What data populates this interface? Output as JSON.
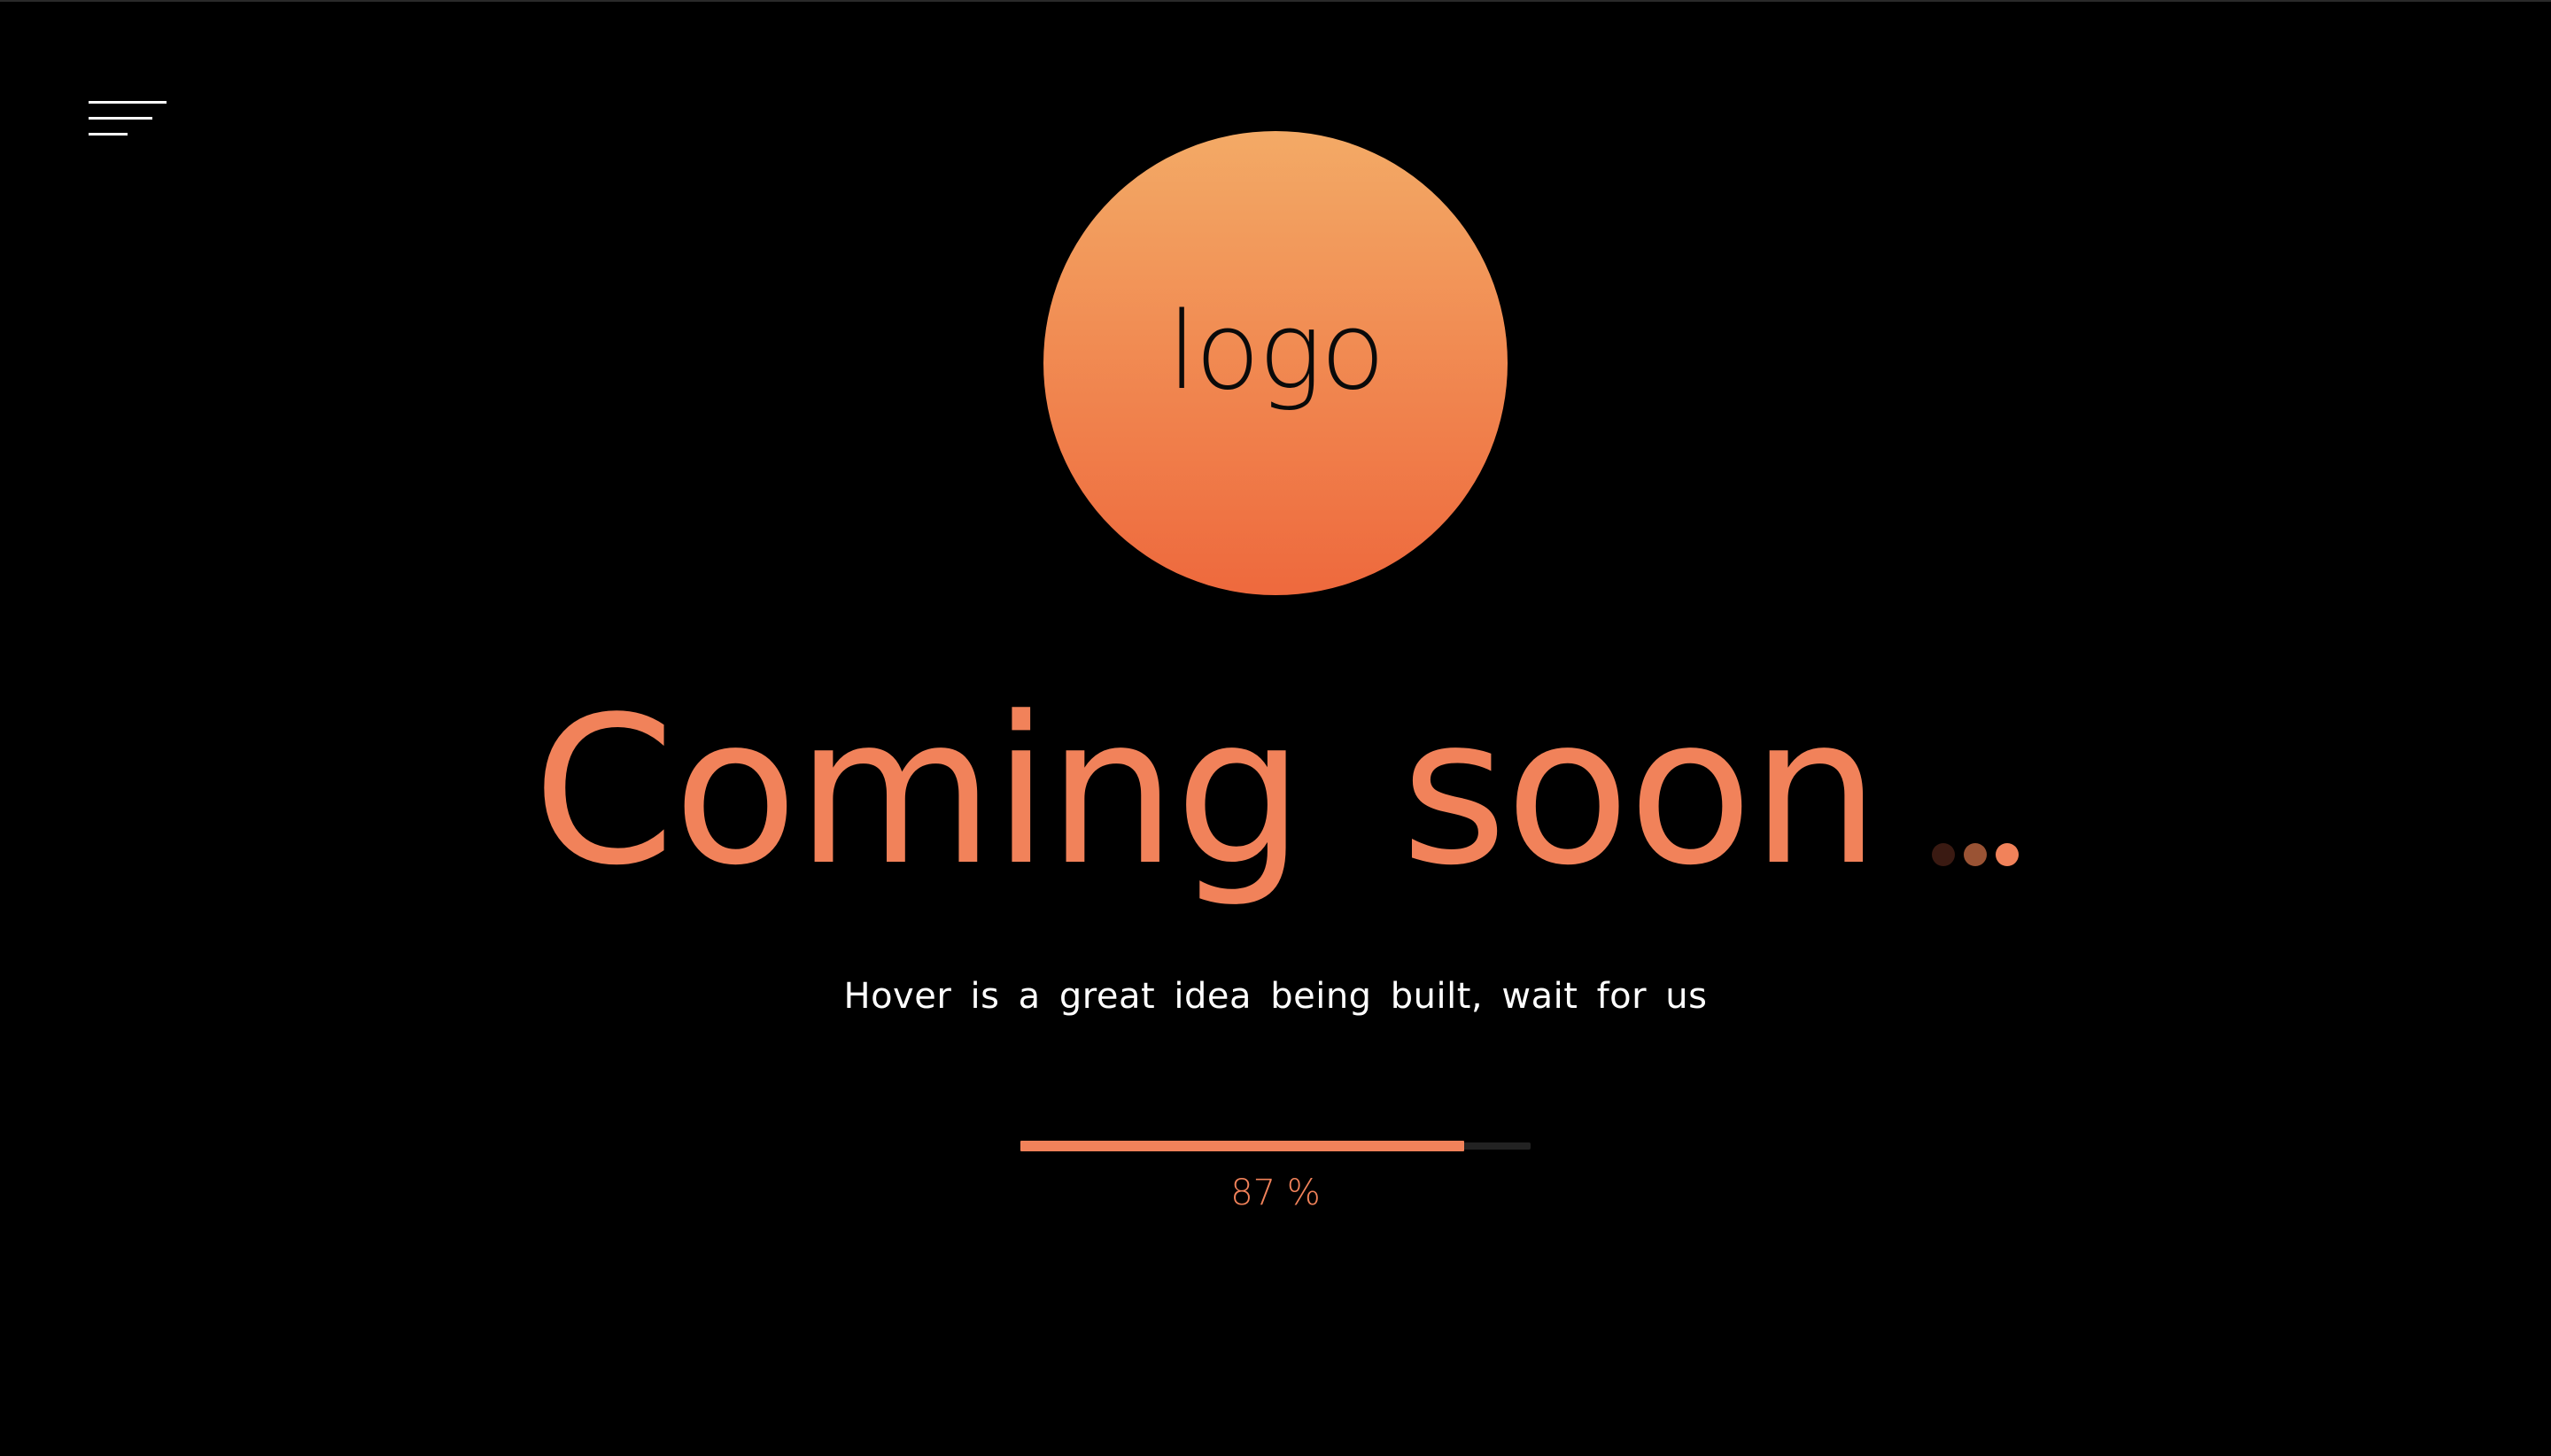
{
  "header": {
    "menu_icon": "hamburger-menu-icon"
  },
  "logo": {
    "text": "logo",
    "gradient_top": "#f3aa66",
    "gradient_bottom": "#ee693d"
  },
  "headline": {
    "text": "Coming soon",
    "color": "#f1825a",
    "dots": [
      {
        "color": "#3a1a12"
      },
      {
        "color": "#9a5334"
      },
      {
        "color": "#f1825a"
      }
    ]
  },
  "subtitle": "Hover is a great idea being built, wait for us",
  "progress": {
    "value": 0.87,
    "label": "87 %",
    "fill_color": "#f1825a",
    "track_color": "#222222"
  }
}
